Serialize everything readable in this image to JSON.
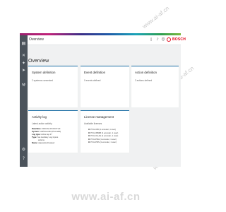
{
  "header": {
    "title": "Overview",
    "brand": "BOSCH"
  },
  "page_title": "Overview",
  "cards": {
    "system": {
      "title": "System definition",
      "subtitle": "2 systems connected"
    },
    "event": {
      "title": "Event definition",
      "subtitle": "0 events defined"
    },
    "action": {
      "title": "Action definition",
      "subtitle": "2 actions defined"
    },
    "activity": {
      "title": "Activity log",
      "subtitle": "Latest action activity",
      "lines": [
        {
          "label": "Date/time:",
          "value": "2023-02-26 09:07:20"
        },
        {
          "label": "System:",
          "value": "HoPlosendkt (Prvendkt)"
        },
        {
          "label": "Log type:",
          "value": "Action ap.17"
        },
        {
          "label": "Type:",
          "value": "Set Auxiliary Log Inputs"
        },
        {
          "label": "",
          "value": "actions"
        },
        {
          "label": "Name:",
          "value": "Aguaustuctivateed"
        }
      ]
    },
    "license": {
      "title": "License management",
      "subtitle": "Available licenses",
      "items": [
        "PVI-LICB (1 encoder, 1 user)",
        "PVI-LIKB2B (1 encoder, 1 user)",
        "PVI-LICLAA (1 encoder, 1 user)",
        "PVI-LPRA (1 encoder, 1 user)",
        "PVI-LPRS (1 encoder, 1 user)"
      ]
    }
  },
  "icons": {
    "sidebar": [
      "overview-icon",
      "systems-icon",
      "events-icon",
      "actions-icon",
      "tools-icon",
      "settings-icon",
      "help-icon"
    ],
    "header": [
      "page-icon",
      "bell-icon",
      "user-icon"
    ]
  },
  "watermark": {
    "text": "www.ai-af.cn",
    "footer": "www.ai-af.cn"
  },
  "colors": {
    "sidebar": "#4b535b",
    "accent": "#1f70a6",
    "brand": "#e20015"
  }
}
